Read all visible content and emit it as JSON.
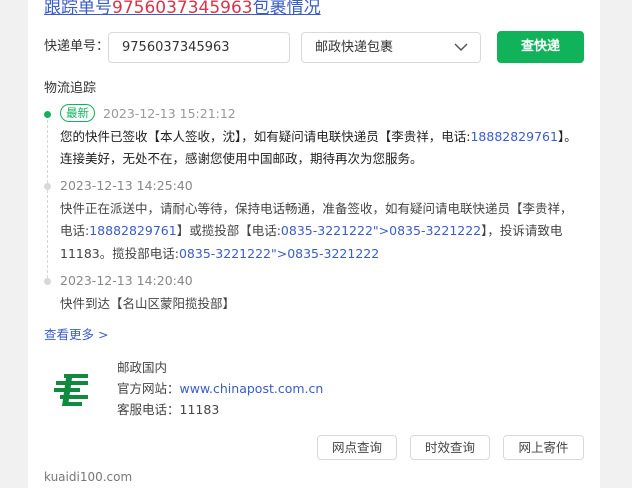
{
  "header": {
    "title_prefix": "跟踪单号",
    "tracking_number": "9756037345963",
    "title_suffix": "包裹情况"
  },
  "search": {
    "label": "快递单号：",
    "input_value": "9756037345963",
    "carrier_selected": "邮政快递包裹",
    "query_label": "查快递"
  },
  "tracking": {
    "section_title": "物流追踪",
    "latest_badge": "最新",
    "events": [
      {
        "time": "2023-12-13 15:21:12",
        "text_a": "您的快件已签收【本人签收，沈】，如有疑问请电联快递员【李贵祥，电话:",
        "phone": "18882829761",
        "text_b": "】。连接美好，无处不在，感谢您使用中国邮政，期待再次为您服务。"
      },
      {
        "time": "2023-12-13 14:25:40",
        "text_a": "快件正在派送中，请耐心等待，保持电话畅通，准备签收，如有疑问请电联快递员【李贵祥，电话:",
        "phone": "18882829761",
        "text_b": "】或揽投部【电话:",
        "phone2": "0835-3221222\">0835-3221222",
        "text_c": "】，投诉请致电11183。揽投部电话:",
        "phone3": "0835-3221222\">0835-3221222"
      },
      {
        "time": "2023-12-13 14:20:40",
        "text": "快件到达【名山区蒙阳揽投部】"
      }
    ],
    "more_label": "查看更多 >"
  },
  "company": {
    "name": "邮政国内",
    "website_label": "官方网站：",
    "website": "www.chinapost.com.cn",
    "phone_label": "客服电话：",
    "phone": "11183",
    "logo_icon": "china-post-logo-icon",
    "logo_color": "#0f8a3e"
  },
  "actions": {
    "outlet_query": "网点查询",
    "time_query": "时效查询",
    "online_send": "网上寄件"
  },
  "footer": {
    "site": "kuaidi100.com"
  },
  "colors": {
    "accent_green": "#10b35a",
    "link_blue": "#3b5cc9",
    "number_red": "#d9334a"
  }
}
